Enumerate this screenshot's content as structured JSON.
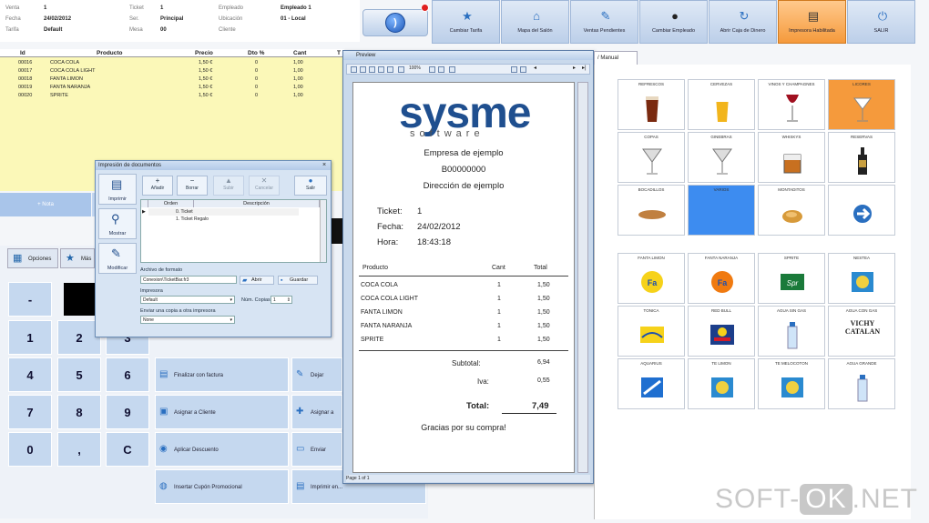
{
  "header": {
    "rows": [
      {
        "k1": "Venta",
        "v1": "1",
        "k2": "Ticket",
        "v2": "1",
        "k3": "Empleado",
        "v3": "Empleado 1"
      },
      {
        "k1": "Fecha",
        "v1": "24/02/2012",
        "k2": "Ser.",
        "v2": "Principal",
        "k3": "Ubicación",
        "v3": "01 - Local"
      },
      {
        "k1": "Tarifa",
        "v1": "Default",
        "k2": "Mesa",
        "v2": "00",
        "k3": "Cliente",
        "v3": ""
      }
    ]
  },
  "toolbar": [
    {
      "label": "Cambiar Tarifa",
      "icon": "star-icon",
      "glyph": "★"
    },
    {
      "label": "Mapa del Salón",
      "icon": "house-icon",
      "glyph": "⌂"
    },
    {
      "label": "Ventas Pendientes",
      "icon": "pen-icon",
      "glyph": "✎"
    },
    {
      "label": "Cambiar Empleado",
      "icon": "person-icon",
      "glyph": "●"
    },
    {
      "label": "Abrir Caja de Dinero",
      "icon": "refresh-icon",
      "glyph": "↻"
    },
    {
      "label": "Impresora Habilitada",
      "icon": "printer-icon",
      "glyph": "▤"
    },
    {
      "label": "SALIR",
      "icon": "power-icon",
      "glyph": "⏻"
    }
  ],
  "order": {
    "columns": [
      "Id",
      "Producto",
      "Precio",
      "Dto %",
      "Cant",
      "T"
    ],
    "rows": [
      {
        "id": "00016",
        "product": "COCA COLA",
        "price": "1,50 €",
        "dto": "0",
        "qty": "1,00"
      },
      {
        "id": "00017",
        "product": "COCA COLA LIGHT",
        "price": "1,50 €",
        "dto": "0",
        "qty": "1,00"
      },
      {
        "id": "00018",
        "product": "FANTA LIMON",
        "price": "1,50 €",
        "dto": "0",
        "qty": "1,00"
      },
      {
        "id": "00019",
        "product": "FANTA NARANJA",
        "price": "1,50 €",
        "dto": "0",
        "qty": "1,00"
      },
      {
        "id": "00020",
        "product": "SPRITE",
        "price": "1,50 €",
        "dto": "0",
        "qty": "1,00"
      }
    ]
  },
  "note_label": "+ Nota",
  "tabs": {
    "opciones": "Opciones",
    "mas": "Más"
  },
  "keypad": [
    "-",
    "1",
    "2",
    "3",
    "4",
    "5",
    "6",
    "7",
    "8",
    "9",
    "0",
    ",",
    "C"
  ],
  "actions": {
    "finalizar": "Finalizar con factura",
    "dejar": "Dejar Pendiente",
    "asignar_cliente": "Asignar a Cliente",
    "asignar_m": "Asignar a M...",
    "aplicar": "Aplicar Descuento",
    "enviar": "Enviar orden",
    "cupon": "Insertar Cupón Promocional",
    "imprimir": "Imprimir en..."
  },
  "dialog": {
    "title": "Impresión de documentos",
    "side": [
      {
        "label": "Imprimir",
        "icon": "printer-icon",
        "glyph": "▤"
      },
      {
        "label": "Mostrar",
        "icon": "magnifier-icon",
        "glyph": "⚲"
      },
      {
        "label": "Modificar",
        "icon": "edit-icon",
        "glyph": "✎"
      }
    ],
    "buttons": [
      {
        "label": "Añadir",
        "glyph": "+"
      },
      {
        "label": "Borrar",
        "glyph": "−"
      },
      {
        "label": "Subir",
        "glyph": "▲"
      },
      {
        "label": "Cancelar",
        "glyph": "✕"
      }
    ],
    "exit_label": "Salir",
    "grid_cols": [
      "Orden",
      "Descripción"
    ],
    "grid_rows": [
      {
        "order": "",
        "desc": "0. Ticket"
      },
      {
        "order": "",
        "desc": "1. Ticket Regalo"
      }
    ],
    "file_label": "Archivo de formato",
    "file_value": "Conexion\\TicketBar.fr3",
    "open_label": "Abrir",
    "save_label": "Guardar",
    "printer_label": "Impresora",
    "printer_value": "Default",
    "copies_label": "Núm. Copias",
    "copies_value": "1",
    "sendcopy_label": "Enviar una copia a otra impresora",
    "sendcopy_value": "None"
  },
  "preview": {
    "title": "Preview",
    "zoom": "100%",
    "page_status": "Page 1 of 1",
    "logo_main": "sysme",
    "logo_sub": "software",
    "company": "Empresa de ejemplo",
    "cif": "B00000000",
    "address": "Dirección de ejemplo",
    "ticket_k": "Ticket:",
    "ticket_v": "1",
    "fecha_k": "Fecha:",
    "fecha_v": "24/02/2012",
    "hora_k": "Hora:",
    "hora_v": "18:43:18",
    "col_product": "Producto",
    "col_qty": "Cant",
    "col_total": "Total",
    "lines": [
      {
        "p": "COCA COLA",
        "c": "1",
        "t": "1,50"
      },
      {
        "p": "COCA COLA LIGHT",
        "c": "1",
        "t": "1,50"
      },
      {
        "p": "FANTA LIMON",
        "c": "1",
        "t": "1,50"
      },
      {
        "p": "FANTA NARANJA",
        "c": "1",
        "t": "1,50"
      },
      {
        "p": "SPRITE",
        "c": "1",
        "t": "1,50"
      }
    ],
    "subtotal_k": "Subtotal:",
    "subtotal_v": "6,94",
    "iva_k": "Iva:",
    "iva_v": "0,55",
    "total_k": "Total:",
    "total_v": "7,49",
    "thanks": "Gracias por su compra!"
  },
  "manual_tab": "/ Manual",
  "grid": {
    "row1": [
      {
        "label": "REFRESCOS",
        "icon": "cola-glass-icon"
      },
      {
        "label": "CERVEZAS",
        "icon": "beer-glass-icon"
      },
      {
        "label": "VINOS Y CHAMPAGNES",
        "icon": "wine-glass-icon"
      },
      {
        "label": "LICORES",
        "icon": "cocktail-glass-icon",
        "active": true
      }
    ],
    "row2": [
      {
        "label": "COPAS",
        "icon": "martini-glass-icon"
      },
      {
        "label": "GINEBRAS",
        "icon": "martini-glass-icon"
      },
      {
        "label": "WHISKYS",
        "icon": "whisky-glass-icon"
      },
      {
        "label": "RESERVAS",
        "icon": "bottle-icon"
      }
    ],
    "row3": [
      {
        "label": "BOCADILLOS",
        "icon": "sandwich-icon"
      },
      {
        "label": "VARIOS",
        "icon": "blank-icon",
        "blue": true
      },
      {
        "label": "MONTADITOS",
        "icon": "tapa-icon"
      },
      {
        "label": "",
        "icon": "arrow-right-icon"
      }
    ],
    "row4": [
      {
        "label": "FANTA LIMON",
        "icon": "fanta-lemon-icon"
      },
      {
        "label": "FANTA NARANJA",
        "icon": "fanta-orange-icon"
      },
      {
        "label": "SPRITE",
        "icon": "sprite-icon"
      },
      {
        "label": "NESTEA",
        "icon": "nestea-icon"
      }
    ],
    "row5": [
      {
        "label": "TONICA",
        "icon": "schweppes-icon"
      },
      {
        "label": "RED BULL",
        "icon": "redbull-icon"
      },
      {
        "label": "AGUA SIN GAS",
        "icon": "water-bottle-icon"
      },
      {
        "label": "AGUA CON GAS",
        "icon": "vichy-icon",
        "text": "VICHY CATALAN"
      }
    ],
    "row6": [
      {
        "label": "AQUARIUS",
        "icon": "aquarius-icon"
      },
      {
        "label": "TE LIMON",
        "icon": "nestea-icon"
      },
      {
        "label": "TE MELOCOTON",
        "icon": "nestea-icon"
      },
      {
        "label": "AGUA GRANDE",
        "icon": "water-bottle-icon"
      }
    ]
  },
  "watermark": {
    "left": "SOFT-",
    "box": "OK",
    ".net": ".NET"
  },
  "colors": {
    "accent": "#2a6fc0",
    "orange": "#f59a3c",
    "orderbg": "#fbf8b8",
    "keys": "#c5d8ef",
    "cellblue": "#3d8cf0"
  }
}
